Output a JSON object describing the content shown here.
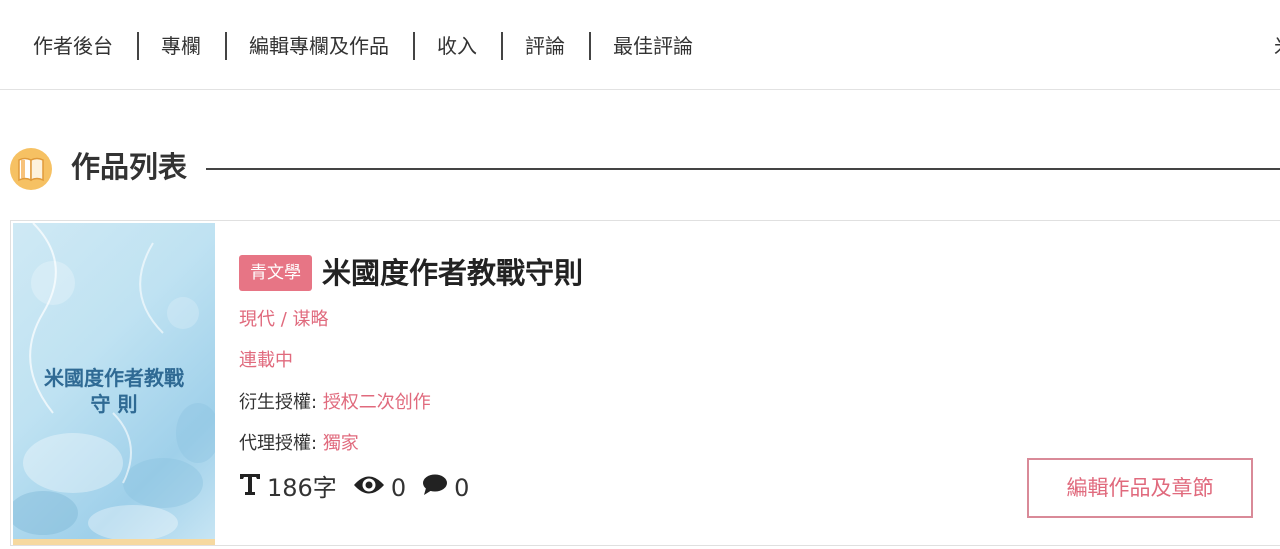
{
  "nav": {
    "items": [
      "作者後台",
      "專欄",
      "編輯專欄及作品",
      "收入",
      "評論",
      "最佳評論"
    ],
    "overflow_char": "米"
  },
  "section": {
    "title": "作品列表",
    "icon": "book-icon"
  },
  "work": {
    "cover_title_line1": "米國度作者教戰",
    "cover_title_line2": "守 則",
    "genre_badge": "青文學",
    "title": "米國度作者教戰守則",
    "category": "現代 / 谋略",
    "status": "連載中",
    "derivative_label": "衍生授權:",
    "derivative_value": "授权二次创作",
    "agency_label": "代理授權:",
    "agency_value": "獨家",
    "word_count": "186字",
    "views": "0",
    "comments": "0",
    "edit_button": "編輯作品及章節"
  },
  "colors": {
    "accent_pink": "#e06a7d",
    "badge_pink": "#e77585",
    "icon_gold": "#f6c163",
    "cover_blue": "#bfe2f2"
  }
}
